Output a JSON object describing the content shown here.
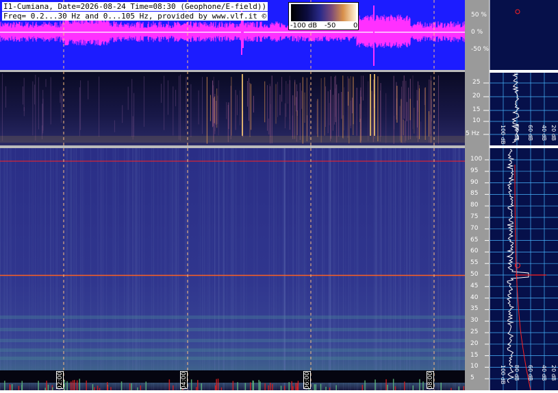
{
  "header": {
    "line1": "I1-Cumiana, Date=2026-08-24 Time=08:30 (Geophone/E-field))",
    "line2": "Freq= 0.2...30 Hz and 0...105 Hz, provided by www.vlf.it ©"
  },
  "colorbar": {
    "min_label": "-100 dB",
    "mid_label": "-50",
    "max_label": "0"
  },
  "waveform_axis": [
    "50 %",
    "0 %",
    "-50 %"
  ],
  "low_freq_axis": [
    "25",
    "20",
    "15",
    "10",
    "5 Hz"
  ],
  "high_freq_axis": [
    "100",
    "95",
    "90",
    "85",
    "80",
    "75",
    "70",
    "65",
    "60",
    "55",
    "50",
    "45",
    "40",
    "35",
    "30",
    "25",
    "20",
    "15",
    "10",
    "5"
  ],
  "time_labels": [
    "02:00",
    "04:00",
    "06:00",
    "08:00"
  ],
  "profile_labels": {
    "low": [
      "100 dB",
      "80 dB",
      "60 dB",
      "40 dB",
      "20 dB"
    ],
    "high": [
      "100 dB",
      "80 dB",
      "60 dB",
      "40 dB",
      "20 dB"
    ]
  },
  "colors": {
    "wave_bg": "#1c1cff",
    "wave_signal": "#ff30ff",
    "axis_bg": "#9a9a9a",
    "profile_bg": "#06104a",
    "grid": "#48b6ff",
    "marker": "#ff2020"
  }
}
